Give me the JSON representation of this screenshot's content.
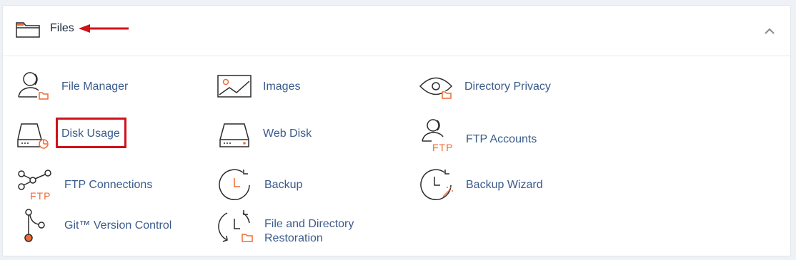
{
  "section": {
    "title": "Files",
    "collapse_icon": "chevron-up-icon"
  },
  "colors": {
    "link": "#3a5b8c",
    "accent_orange": "#f06a35",
    "annotation_red": "#d0121b",
    "icon_stroke": "#2b2b2b"
  },
  "items": [
    {
      "label": "File Manager",
      "icon": "file-manager-icon"
    },
    {
      "label": "Images",
      "icon": "images-icon"
    },
    {
      "label": "Directory Privacy",
      "icon": "directory-privacy-icon"
    },
    {
      "label": "Disk Usage",
      "icon": "disk-usage-icon"
    },
    {
      "label": "Web Disk",
      "icon": "web-disk-icon"
    },
    {
      "label": "FTP Accounts",
      "icon": "ftp-accounts-icon",
      "icon_text": "FTP"
    },
    {
      "label": "FTP Connections",
      "icon": "ftp-connections-icon",
      "icon_text": "FTP"
    },
    {
      "label": "Backup",
      "icon": "backup-icon"
    },
    {
      "label": "Backup Wizard",
      "icon": "backup-wizard-icon"
    },
    {
      "label": "Git™ Version Control",
      "icon": "git-version-control-icon"
    },
    {
      "label_line1": "File and Directory",
      "label_line2": "Restoration",
      "icon": "file-restoration-icon"
    }
  ]
}
